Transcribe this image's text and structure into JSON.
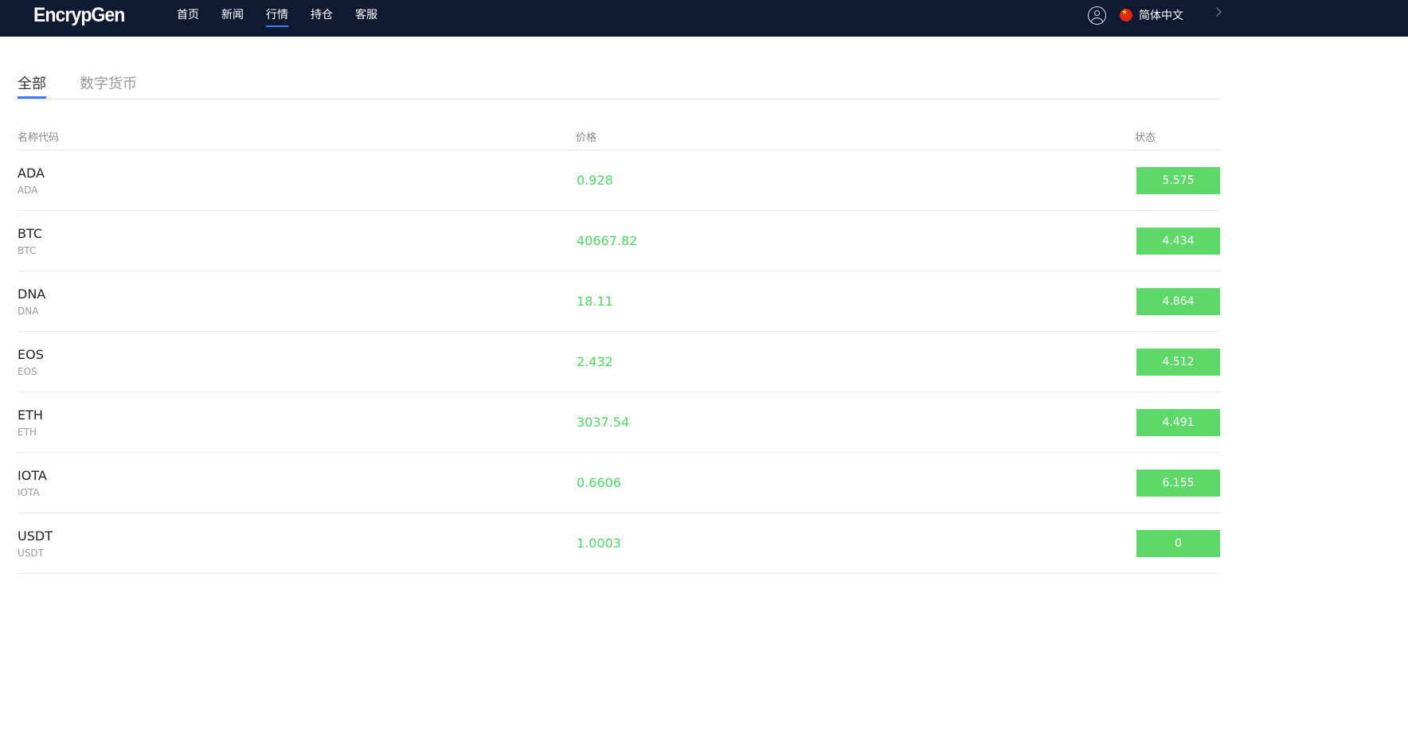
{
  "header": {
    "logo": "EncrypGen",
    "nav": [
      "首页",
      "新闻",
      "行情",
      "持仓",
      "客服"
    ],
    "active_nav": 2,
    "language": "简体中文"
  },
  "tabs": {
    "items": [
      "全部",
      "数字货币"
    ],
    "active": 0
  },
  "table": {
    "columns": {
      "name": "名称代码",
      "price": "价格",
      "status": "状态"
    },
    "rows": [
      {
        "symbol": "ADA",
        "code": "ADA",
        "price": "0.928",
        "status": "5.575"
      },
      {
        "symbol": "BTC",
        "code": "BTC",
        "price": "40667.82",
        "status": "4.434"
      },
      {
        "symbol": "DNA",
        "code": "DNA",
        "price": "18.11",
        "status": "4.864"
      },
      {
        "symbol": "EOS",
        "code": "EOS",
        "price": "2.432",
        "status": "4.512"
      },
      {
        "symbol": "ETH",
        "code": "ETH",
        "price": "3037.54",
        "status": "4.491"
      },
      {
        "symbol": "IOTA",
        "code": "IOTA",
        "price": "0.6606",
        "status": "6.155"
      },
      {
        "symbol": "USDT",
        "code": "USDT",
        "price": "1.0003",
        "status": "0"
      }
    ]
  },
  "colors": {
    "header_bg": "#101a33",
    "accent": "#3b7cff",
    "price_up": "#4cd964",
    "badge_up": "#5ed868"
  },
  "icons": {
    "user": "user-circle-icon",
    "flag": "china-flag-icon",
    "chevron": "chevron-right-icon"
  }
}
